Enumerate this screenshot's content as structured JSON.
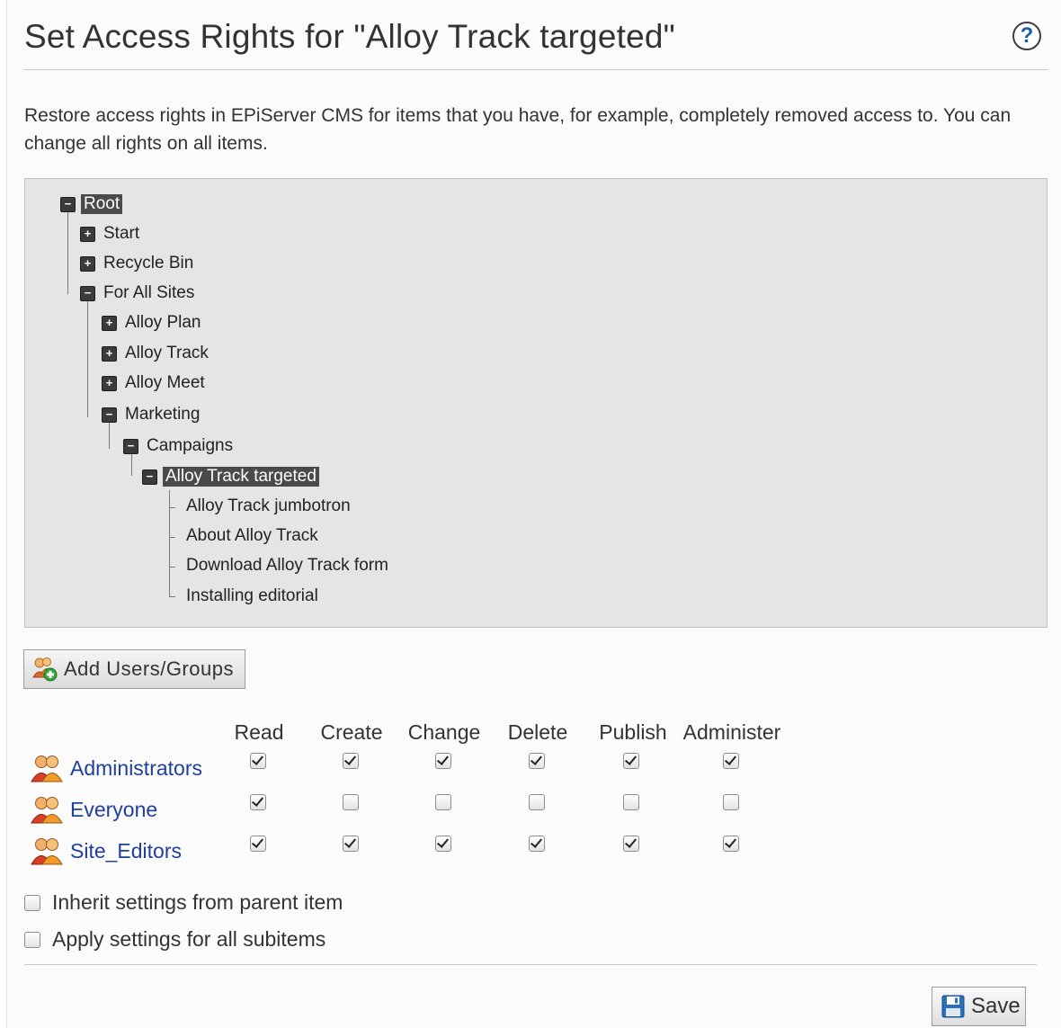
{
  "title": "Set Access Rights for \"Alloy Track targeted\"",
  "help_icon": "question-icon",
  "description": "Restore access rights in EPiServer CMS for items that you have, for example, completely removed access to. You can change all rights on all items.",
  "tree": {
    "root": "Root",
    "start": "Start",
    "recycle_bin": "Recycle Bin",
    "for_all_sites": "For All Sites",
    "alloy_plan": "Alloy Plan",
    "alloy_track": "Alloy Track",
    "alloy_meet": "Alloy Meet",
    "marketing": "Marketing",
    "campaigns": "Campaigns",
    "alloy_track_targeted": "Alloy Track targeted",
    "leaves": [
      "Alloy Track jumbotron",
      "About Alloy Track",
      "Download Alloy Track form",
      "Installing editorial"
    ],
    "selected": [
      "Root",
      "Alloy Track targeted"
    ],
    "expanded": [
      "Root",
      "For All Sites",
      "Marketing",
      "Campaigns",
      "Alloy Track targeted"
    ]
  },
  "add_button_label": "Add Users/Groups",
  "permissions": {
    "columns": [
      "Read",
      "Create",
      "Change",
      "Delete",
      "Publish",
      "Administer"
    ],
    "rows": [
      {
        "name": "Administrators",
        "values": [
          true,
          true,
          true,
          true,
          true,
          true
        ]
      },
      {
        "name": "Everyone",
        "values": [
          true,
          false,
          false,
          false,
          false,
          false
        ]
      },
      {
        "name": "Site_Editors",
        "values": [
          true,
          true,
          true,
          true,
          true,
          true
        ]
      }
    ]
  },
  "options": {
    "inherit": {
      "label": "Inherit settings from parent item",
      "checked": false
    },
    "apply_subitems": {
      "label": "Apply settings for all subitems",
      "checked": false
    }
  },
  "save_label": "Save",
  "colors": {
    "link": "#1f3f9e",
    "selected_bg": "#4a4a4a",
    "tree_bg": "#e5e5e5"
  }
}
